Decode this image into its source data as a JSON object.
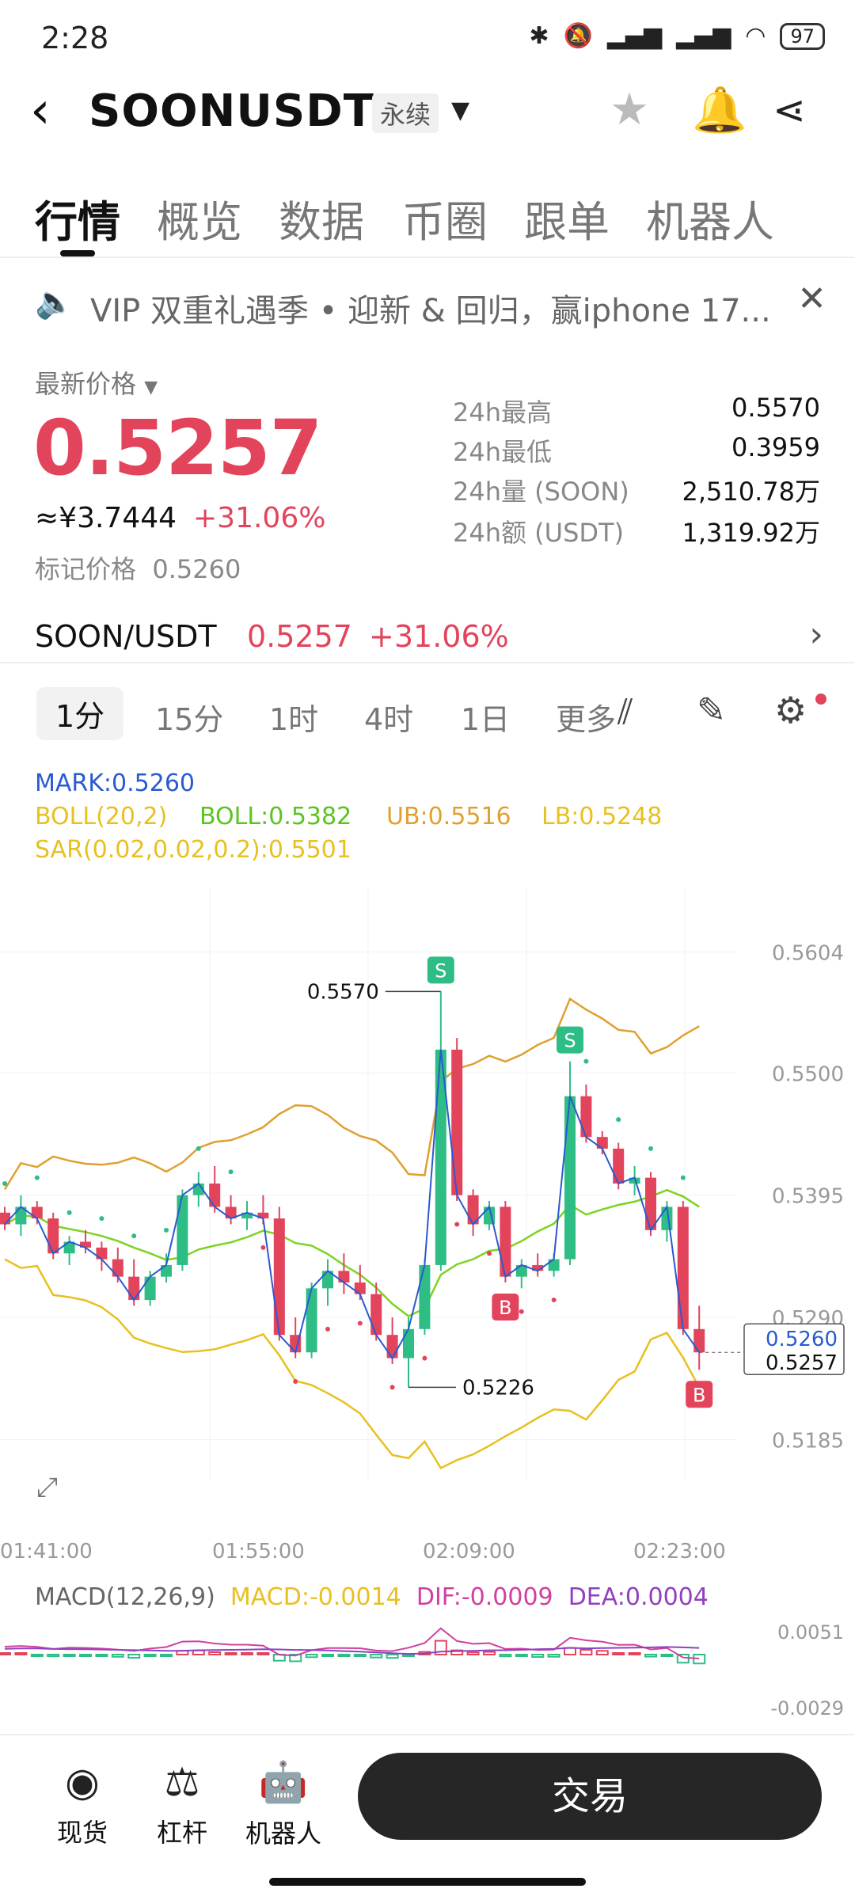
{
  "status": {
    "time": "2:28",
    "battery": "97"
  },
  "header": {
    "pair": "SOONUSDT",
    "contract_type": "永续"
  },
  "tabs": [
    "行情",
    "概览",
    "数据",
    "币圈",
    "跟单",
    "机器人"
  ],
  "notice": "VIP 双重礼遇季 • 迎新 & 回归，赢iphone 17...",
  "price": {
    "latest_label": "最新价格",
    "last": "0.5257",
    "cny": "≈¥3.7444",
    "change": "+31.06%",
    "mark_label": "标记价格",
    "mark": "0.5260"
  },
  "stats": [
    {
      "k": "24h最高",
      "v": "0.5570"
    },
    {
      "k": "24h最低",
      "v": "0.3959"
    },
    {
      "k": "24h量 (SOON)",
      "v": "2,510.78万"
    },
    {
      "k": "24h额 (USDT)",
      "v": "1,319.92万"
    }
  ],
  "spot": {
    "pair": "SOON/USDT",
    "price": "0.5257",
    "change": "+31.06%"
  },
  "intervals": [
    "1分",
    "15分",
    "1时",
    "4时",
    "1日",
    "更多"
  ],
  "legend": {
    "mark": "MARK:0.5260",
    "boll_params": "BOLL(20,2)",
    "boll": "BOLL:0.5382",
    "ub": "UB:0.5516",
    "lb": "LB:0.5248",
    "sar": "SAR(0.02,0.02,0.2):0.5501"
  },
  "macd_legend": {
    "params": "MACD(12,26,9)",
    "macd": "MACD:-0.0014",
    "dif": "DIF:-0.0009",
    "dea": "DEA:0.0004"
  },
  "colors": {
    "up": "#2ebd85",
    "down": "#e2445c",
    "boll_mid": "#7ed321",
    "boll_band": "#e0a030",
    "sar": "#2ebd85",
    "lb": "#e8c020"
  },
  "chart_data": {
    "type": "candlestick",
    "y_ticks": [
      "0.5604",
      "0.5500",
      "0.5395",
      "0.5290",
      "0.5185"
    ],
    "x_ticks": [
      "01:41:00",
      "01:55:00",
      "02:09:00",
      "02:23:00"
    ],
    "ylim": [
      0.515,
      0.566
    ],
    "high_label": "0.5570",
    "low_label": "0.5226",
    "last_mark": "0.5260",
    "last_price": "0.5257",
    "markers": [
      "S",
      "S",
      "B",
      "B"
    ],
    "candles": [
      [
        0.538,
        0.5385,
        0.5365,
        0.537
      ],
      [
        0.537,
        0.5395,
        0.536,
        0.5385
      ],
      [
        0.5385,
        0.539,
        0.537,
        0.5375
      ],
      [
        0.5375,
        0.538,
        0.534,
        0.5345
      ],
      [
        0.5345,
        0.536,
        0.5335,
        0.5355
      ],
      [
        0.5355,
        0.5365,
        0.5345,
        0.535
      ],
      [
        0.535,
        0.5355,
        0.533,
        0.534
      ],
      [
        0.534,
        0.535,
        0.532,
        0.5325
      ],
      [
        0.5325,
        0.534,
        0.53,
        0.5305
      ],
      [
        0.5305,
        0.533,
        0.53,
        0.5325
      ],
      [
        0.5325,
        0.5345,
        0.532,
        0.5335
      ],
      [
        0.5335,
        0.54,
        0.533,
        0.5395
      ],
      [
        0.5395,
        0.5415,
        0.5385,
        0.5405
      ],
      [
        0.5405,
        0.542,
        0.538,
        0.5385
      ],
      [
        0.5385,
        0.5395,
        0.537,
        0.5375
      ],
      [
        0.5375,
        0.539,
        0.5365,
        0.538
      ],
      [
        0.538,
        0.5395,
        0.537,
        0.5375
      ],
      [
        0.5375,
        0.5385,
        0.527,
        0.5275
      ],
      [
        0.5275,
        0.529,
        0.5255,
        0.526
      ],
      [
        0.526,
        0.532,
        0.5255,
        0.5315
      ],
      [
        0.5315,
        0.534,
        0.53,
        0.533
      ],
      [
        0.533,
        0.5345,
        0.531,
        0.532
      ],
      [
        0.532,
        0.5335,
        0.5305,
        0.531
      ],
      [
        0.531,
        0.532,
        0.527,
        0.5275
      ],
      [
        0.5275,
        0.529,
        0.525,
        0.5255
      ],
      [
        0.5255,
        0.529,
        0.523,
        0.528
      ],
      [
        0.528,
        0.534,
        0.5275,
        0.5335
      ],
      [
        0.5335,
        0.557,
        0.533,
        0.552
      ],
      [
        0.552,
        0.553,
        0.539,
        0.5395
      ],
      [
        0.5395,
        0.54,
        0.536,
        0.537
      ],
      [
        0.537,
        0.539,
        0.5365,
        0.5385
      ],
      [
        0.5385,
        0.539,
        0.532,
        0.5325
      ],
      [
        0.5325,
        0.534,
        0.5315,
        0.5335
      ],
      [
        0.5335,
        0.5345,
        0.5325,
        0.533
      ],
      [
        0.533,
        0.5345,
        0.5325,
        0.534
      ],
      [
        0.534,
        0.551,
        0.5335,
        0.548
      ],
      [
        0.548,
        0.549,
        0.544,
        0.5445
      ],
      [
        0.5445,
        0.545,
        0.543,
        0.5435
      ],
      [
        0.5435,
        0.544,
        0.54,
        0.5405
      ],
      [
        0.5405,
        0.542,
        0.5395,
        0.541
      ],
      [
        0.541,
        0.5415,
        0.536,
        0.5365
      ],
      [
        0.5365,
        0.539,
        0.5355,
        0.5385
      ],
      [
        0.5385,
        0.539,
        0.5275,
        0.528
      ],
      [
        0.528,
        0.53,
        0.5245,
        0.526
      ]
    ]
  }
}
